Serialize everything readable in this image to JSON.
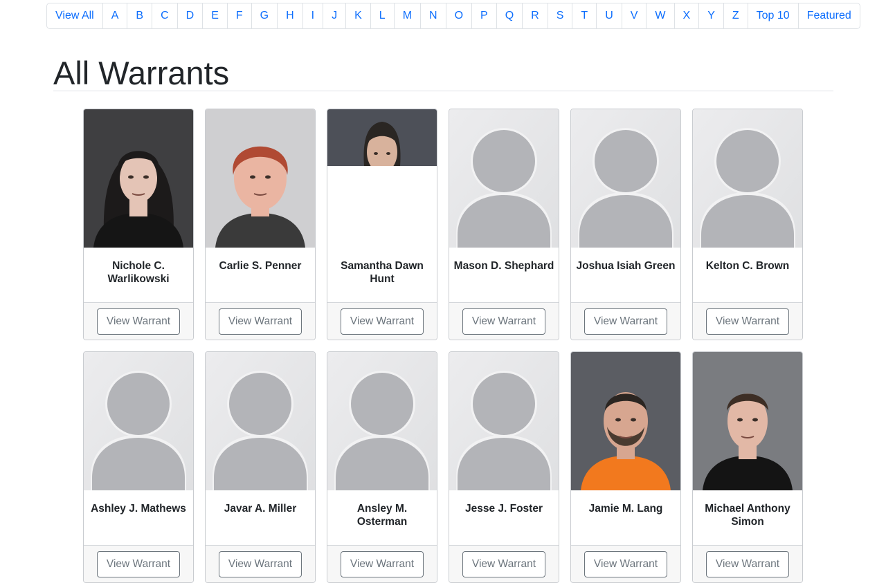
{
  "nav": {
    "items": [
      "View All",
      "A",
      "B",
      "C",
      "D",
      "E",
      "F",
      "G",
      "H",
      "I",
      "J",
      "K",
      "L",
      "M",
      "N",
      "O",
      "P",
      "Q",
      "R",
      "S",
      "T",
      "U",
      "V",
      "W",
      "X",
      "Y",
      "Z",
      "Top 10",
      "Featured"
    ]
  },
  "page": {
    "title": "All Warrants"
  },
  "cards": [
    {
      "name": "Nichole C. Warlikowski",
      "photo": "photo-mugshot-woman-dark-hair",
      "button": "View Warrant"
    },
    {
      "name": "Carlie S. Penner",
      "photo": "photo-mugshot-woman-red-hair",
      "button": "View Warrant"
    },
    {
      "name": "Samantha Dawn Hunt",
      "photo": "photo-mugshot-woman-partial",
      "button": "View Warrant"
    },
    {
      "name": "Mason D. Shephard",
      "photo": "placeholder-avatar-icon",
      "button": "View Warrant"
    },
    {
      "name": "Joshua Isiah Green",
      "photo": "placeholder-avatar-icon",
      "button": "View Warrant"
    },
    {
      "name": "Kelton C. Brown",
      "photo": "placeholder-avatar-icon",
      "button": "View Warrant"
    },
    {
      "name": "Ashley J. Mathews",
      "photo": "placeholder-avatar-icon",
      "button": "View Warrant"
    },
    {
      "name": "Javar A. Miller",
      "photo": "placeholder-avatar-icon",
      "button": "View Warrant"
    },
    {
      "name": "Ansley M. Osterman",
      "photo": "placeholder-avatar-icon",
      "button": "View Warrant"
    },
    {
      "name": "Jesse J. Foster",
      "photo": "placeholder-avatar-icon",
      "button": "View Warrant"
    },
    {
      "name": "Jamie M. Lang",
      "photo": "photo-mugshot-man-orange-shirt",
      "button": "View Warrant"
    },
    {
      "name": "Michael Anthony Simon",
      "photo": "photo-mugshot-man-black-shirt",
      "button": "View Warrant"
    }
  ],
  "colors": {
    "link": "#0d6efd",
    "placeholder_bg": "#e6e7e9",
    "placeholder_fg": "#b3b4b8"
  }
}
